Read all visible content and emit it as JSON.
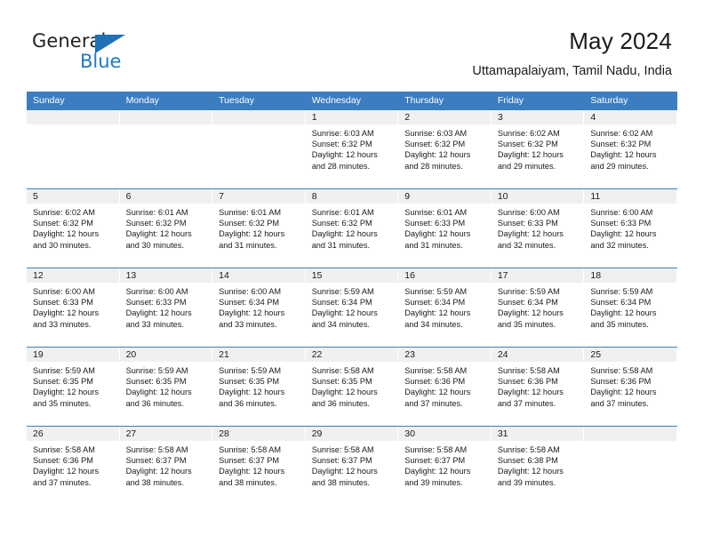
{
  "brand": {
    "name_part1": "General",
    "name_part2": "Blue",
    "flag_icon": "triangle-flag-icon"
  },
  "header": {
    "title": "May 2024",
    "subtitle": "Uttamapalaiyam, Tamil Nadu, India"
  },
  "colors": {
    "header_blue": "#3c7dc0",
    "brand_blue": "#1e7ac4",
    "daynum_strip": "#f0f0f0",
    "text": "#1a1a1a"
  },
  "calendar": {
    "weekday_headers": [
      "Sunday",
      "Monday",
      "Tuesday",
      "Wednesday",
      "Thursday",
      "Friday",
      "Saturday"
    ],
    "labels": {
      "sunrise": "Sunrise:",
      "sunset": "Sunset:",
      "daylight": "Daylight:"
    },
    "weeks": [
      [
        {
          "day": "",
          "empty": true
        },
        {
          "day": "",
          "empty": true
        },
        {
          "day": "",
          "empty": true
        },
        {
          "day": "1",
          "sunrise": "Sunrise: 6:03 AM",
          "sunset": "Sunset: 6:32 PM",
          "daylight_l1": "Daylight: 12 hours",
          "daylight_l2": "and 28 minutes."
        },
        {
          "day": "2",
          "sunrise": "Sunrise: 6:03 AM",
          "sunset": "Sunset: 6:32 PM",
          "daylight_l1": "Daylight: 12 hours",
          "daylight_l2": "and 28 minutes."
        },
        {
          "day": "3",
          "sunrise": "Sunrise: 6:02 AM",
          "sunset": "Sunset: 6:32 PM",
          "daylight_l1": "Daylight: 12 hours",
          "daylight_l2": "and 29 minutes."
        },
        {
          "day": "4",
          "sunrise": "Sunrise: 6:02 AM",
          "sunset": "Sunset: 6:32 PM",
          "daylight_l1": "Daylight: 12 hours",
          "daylight_l2": "and 29 minutes."
        }
      ],
      [
        {
          "day": "5",
          "sunrise": "Sunrise: 6:02 AM",
          "sunset": "Sunset: 6:32 PM",
          "daylight_l1": "Daylight: 12 hours",
          "daylight_l2": "and 30 minutes."
        },
        {
          "day": "6",
          "sunrise": "Sunrise: 6:01 AM",
          "sunset": "Sunset: 6:32 PM",
          "daylight_l1": "Daylight: 12 hours",
          "daylight_l2": "and 30 minutes."
        },
        {
          "day": "7",
          "sunrise": "Sunrise: 6:01 AM",
          "sunset": "Sunset: 6:32 PM",
          "daylight_l1": "Daylight: 12 hours",
          "daylight_l2": "and 31 minutes."
        },
        {
          "day": "8",
          "sunrise": "Sunrise: 6:01 AM",
          "sunset": "Sunset: 6:32 PM",
          "daylight_l1": "Daylight: 12 hours",
          "daylight_l2": "and 31 minutes."
        },
        {
          "day": "9",
          "sunrise": "Sunrise: 6:01 AM",
          "sunset": "Sunset: 6:33 PM",
          "daylight_l1": "Daylight: 12 hours",
          "daylight_l2": "and 31 minutes."
        },
        {
          "day": "10",
          "sunrise": "Sunrise: 6:00 AM",
          "sunset": "Sunset: 6:33 PM",
          "daylight_l1": "Daylight: 12 hours",
          "daylight_l2": "and 32 minutes."
        },
        {
          "day": "11",
          "sunrise": "Sunrise: 6:00 AM",
          "sunset": "Sunset: 6:33 PM",
          "daylight_l1": "Daylight: 12 hours",
          "daylight_l2": "and 32 minutes."
        }
      ],
      [
        {
          "day": "12",
          "sunrise": "Sunrise: 6:00 AM",
          "sunset": "Sunset: 6:33 PM",
          "daylight_l1": "Daylight: 12 hours",
          "daylight_l2": "and 33 minutes."
        },
        {
          "day": "13",
          "sunrise": "Sunrise: 6:00 AM",
          "sunset": "Sunset: 6:33 PM",
          "daylight_l1": "Daylight: 12 hours",
          "daylight_l2": "and 33 minutes."
        },
        {
          "day": "14",
          "sunrise": "Sunrise: 6:00 AM",
          "sunset": "Sunset: 6:34 PM",
          "daylight_l1": "Daylight: 12 hours",
          "daylight_l2": "and 33 minutes."
        },
        {
          "day": "15",
          "sunrise": "Sunrise: 5:59 AM",
          "sunset": "Sunset: 6:34 PM",
          "daylight_l1": "Daylight: 12 hours",
          "daylight_l2": "and 34 minutes."
        },
        {
          "day": "16",
          "sunrise": "Sunrise: 5:59 AM",
          "sunset": "Sunset: 6:34 PM",
          "daylight_l1": "Daylight: 12 hours",
          "daylight_l2": "and 34 minutes."
        },
        {
          "day": "17",
          "sunrise": "Sunrise: 5:59 AM",
          "sunset": "Sunset: 6:34 PM",
          "daylight_l1": "Daylight: 12 hours",
          "daylight_l2": "and 35 minutes."
        },
        {
          "day": "18",
          "sunrise": "Sunrise: 5:59 AM",
          "sunset": "Sunset: 6:34 PM",
          "daylight_l1": "Daylight: 12 hours",
          "daylight_l2": "and 35 minutes."
        }
      ],
      [
        {
          "day": "19",
          "sunrise": "Sunrise: 5:59 AM",
          "sunset": "Sunset: 6:35 PM",
          "daylight_l1": "Daylight: 12 hours",
          "daylight_l2": "and 35 minutes."
        },
        {
          "day": "20",
          "sunrise": "Sunrise: 5:59 AM",
          "sunset": "Sunset: 6:35 PM",
          "daylight_l1": "Daylight: 12 hours",
          "daylight_l2": "and 36 minutes."
        },
        {
          "day": "21",
          "sunrise": "Sunrise: 5:59 AM",
          "sunset": "Sunset: 6:35 PM",
          "daylight_l1": "Daylight: 12 hours",
          "daylight_l2": "and 36 minutes."
        },
        {
          "day": "22",
          "sunrise": "Sunrise: 5:58 AM",
          "sunset": "Sunset: 6:35 PM",
          "daylight_l1": "Daylight: 12 hours",
          "daylight_l2": "and 36 minutes."
        },
        {
          "day": "23",
          "sunrise": "Sunrise: 5:58 AM",
          "sunset": "Sunset: 6:36 PM",
          "daylight_l1": "Daylight: 12 hours",
          "daylight_l2": "and 37 minutes."
        },
        {
          "day": "24",
          "sunrise": "Sunrise: 5:58 AM",
          "sunset": "Sunset: 6:36 PM",
          "daylight_l1": "Daylight: 12 hours",
          "daylight_l2": "and 37 minutes."
        },
        {
          "day": "25",
          "sunrise": "Sunrise: 5:58 AM",
          "sunset": "Sunset: 6:36 PM",
          "daylight_l1": "Daylight: 12 hours",
          "daylight_l2": "and 37 minutes."
        }
      ],
      [
        {
          "day": "26",
          "sunrise": "Sunrise: 5:58 AM",
          "sunset": "Sunset: 6:36 PM",
          "daylight_l1": "Daylight: 12 hours",
          "daylight_l2": "and 37 minutes."
        },
        {
          "day": "27",
          "sunrise": "Sunrise: 5:58 AM",
          "sunset": "Sunset: 6:37 PM",
          "daylight_l1": "Daylight: 12 hours",
          "daylight_l2": "and 38 minutes."
        },
        {
          "day": "28",
          "sunrise": "Sunrise: 5:58 AM",
          "sunset": "Sunset: 6:37 PM",
          "daylight_l1": "Daylight: 12 hours",
          "daylight_l2": "and 38 minutes."
        },
        {
          "day": "29",
          "sunrise": "Sunrise: 5:58 AM",
          "sunset": "Sunset: 6:37 PM",
          "daylight_l1": "Daylight: 12 hours",
          "daylight_l2": "and 38 minutes."
        },
        {
          "day": "30",
          "sunrise": "Sunrise: 5:58 AM",
          "sunset": "Sunset: 6:37 PM",
          "daylight_l1": "Daylight: 12 hours",
          "daylight_l2": "and 39 minutes."
        },
        {
          "day": "31",
          "sunrise": "Sunrise: 5:58 AM",
          "sunset": "Sunset: 6:38 PM",
          "daylight_l1": "Daylight: 12 hours",
          "daylight_l2": "and 39 minutes."
        },
        {
          "day": "",
          "empty": true
        }
      ]
    ]
  }
}
